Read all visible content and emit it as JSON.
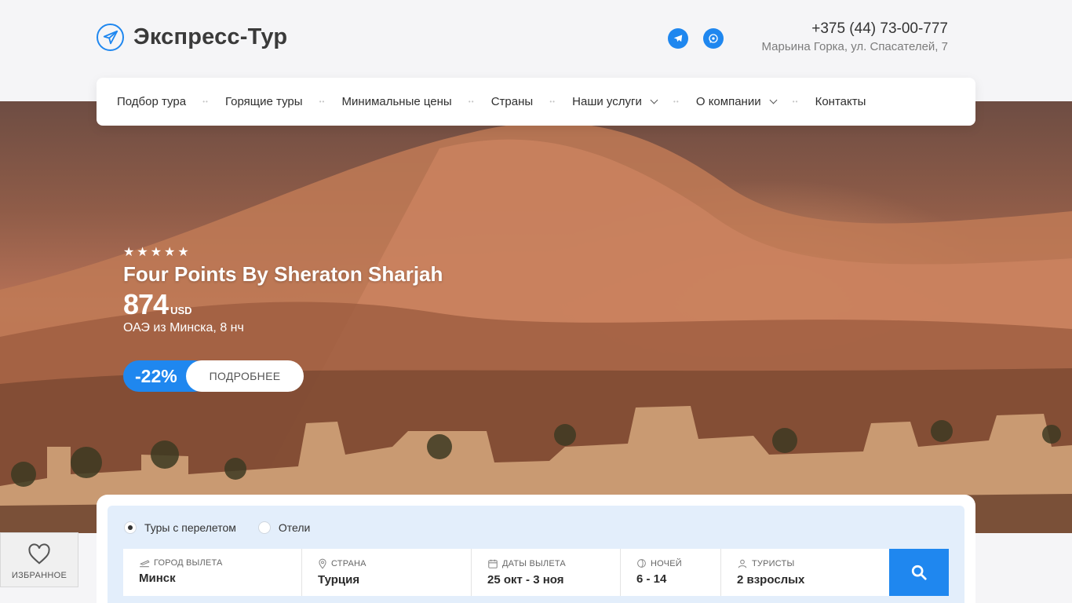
{
  "brand": {
    "name": "Экспресс-Тур",
    "icon": "plane-icon",
    "accent": "#1f87ef"
  },
  "social": [
    {
      "name": "telegram",
      "icon": "telegram-icon"
    },
    {
      "name": "whatsapp",
      "icon": "whatsapp-icon"
    }
  ],
  "contact": {
    "phone": "+375 (44) 73-00-777",
    "address": "Марьина Горка, ул. Спасателей, 7"
  },
  "nav": {
    "items": [
      {
        "label": "Подбор тура",
        "has_dropdown": false
      },
      {
        "label": "Горящие туры",
        "has_dropdown": false
      },
      {
        "label": "Минимальные цены",
        "has_dropdown": false
      },
      {
        "label": "Страны",
        "has_dropdown": false
      },
      {
        "label": "Наши услуги",
        "has_dropdown": true
      },
      {
        "label": "О компании",
        "has_dropdown": true
      },
      {
        "label": "Контакты",
        "has_dropdown": false
      }
    ]
  },
  "hero": {
    "stars": 5,
    "hotel_name": "Four Points By Sheraton Sharjah",
    "price": "874",
    "currency": "USD",
    "route": "ОАЭ из Минска, 8 нч",
    "discount": "-22%",
    "more_label": "ПОДРОБНЕЕ"
  },
  "search": {
    "modes": [
      {
        "label": "Туры с перелетом",
        "selected": true
      },
      {
        "label": "Отели",
        "selected": false
      }
    ],
    "fields": [
      {
        "label": "ГОРОД ВЫЛЕТА",
        "value": "Минск",
        "icon": "departure-icon"
      },
      {
        "label": "СТРАНА",
        "value": "Турция",
        "icon": "location-pin-icon"
      },
      {
        "label": "ДАТЫ ВЫЛЕТА",
        "value": "25 окт - 3 ноя",
        "icon": "calendar-icon"
      },
      {
        "label": "НОЧЕЙ",
        "value": "6 - 14",
        "icon": "moon-icon"
      },
      {
        "label": "ТУРИСТЫ",
        "value": "2 взрослых",
        "icon": "user-icon"
      }
    ],
    "submit_icon": "search-icon"
  },
  "favorites": {
    "label": "ИЗБРАННОЕ",
    "icon": "heart-icon"
  }
}
